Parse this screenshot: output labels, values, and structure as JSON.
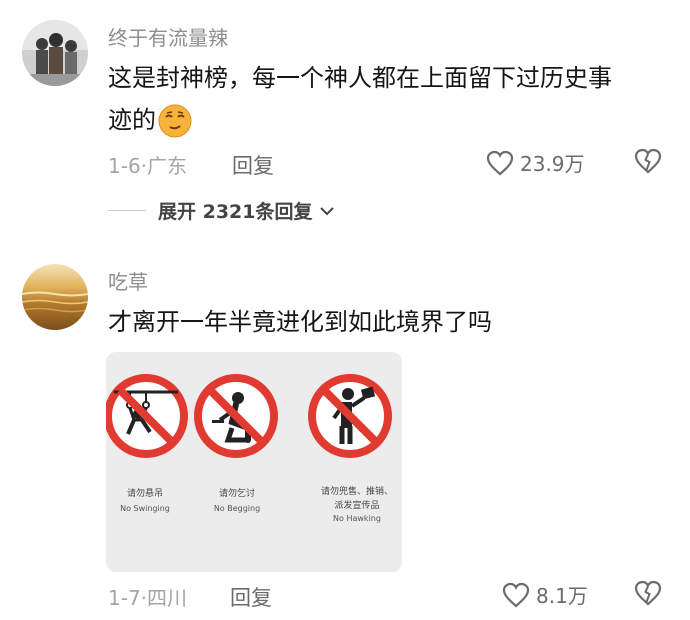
{
  "comments": [
    {
      "username": "终于有流量辣",
      "content_line1": "这是封神榜，每一个神人都在上面留下过历史事",
      "content_line2": "迹的",
      "date": "1-6",
      "location": "广东",
      "reply_label": "回复",
      "likes": "23.9万",
      "expand_label": "展开 2321条回复",
      "avatar": "group-photo-avatar",
      "sticker": "smug-face-emoji"
    },
    {
      "username": "吃草",
      "content": "才离开一年半竟进化到如此境界了吗",
      "date": "1-7",
      "location": "四川",
      "reply_label": "回复",
      "likes": "8.1万",
      "avatar": "golden-water-avatar",
      "image": {
        "signs": [
          {
            "cn": "请勿悬吊",
            "en": "No Swinging",
            "icon": "no-swinging-icon"
          },
          {
            "cn": "请勿乞讨",
            "en": "No Begging",
            "icon": "no-begging-icon"
          },
          {
            "cn_line1": "请勿兜售、推销、",
            "cn_line2": "派发宣传品",
            "en": "No Hawking",
            "icon": "no-hawking-icon"
          }
        ]
      }
    }
  ],
  "colors": {
    "prohibit_red": "#e03a31",
    "meta_gray": "#a5a5a5",
    "name_gray": "#8e8e8e"
  }
}
